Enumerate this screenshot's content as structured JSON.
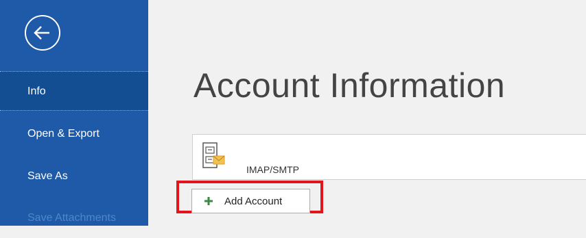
{
  "sidebar": {
    "back_icon": "arrow-left-circle-icon",
    "items": [
      {
        "label": "Info"
      },
      {
        "label": "Open & Export"
      },
      {
        "label": "Save As"
      },
      {
        "label": "Save Attachments"
      }
    ]
  },
  "main": {
    "title": "Account Information",
    "account": {
      "type": "IMAP/SMTP",
      "icon": "mail-server-icon"
    },
    "add_account": {
      "label": "Add Account",
      "icon": "plus-icon"
    }
  },
  "colors": {
    "sidebar_bg": "#1e5aa8",
    "sidebar_active": "#134e92",
    "highlight": "#e3141c",
    "plus_green": "#3a8a44"
  }
}
